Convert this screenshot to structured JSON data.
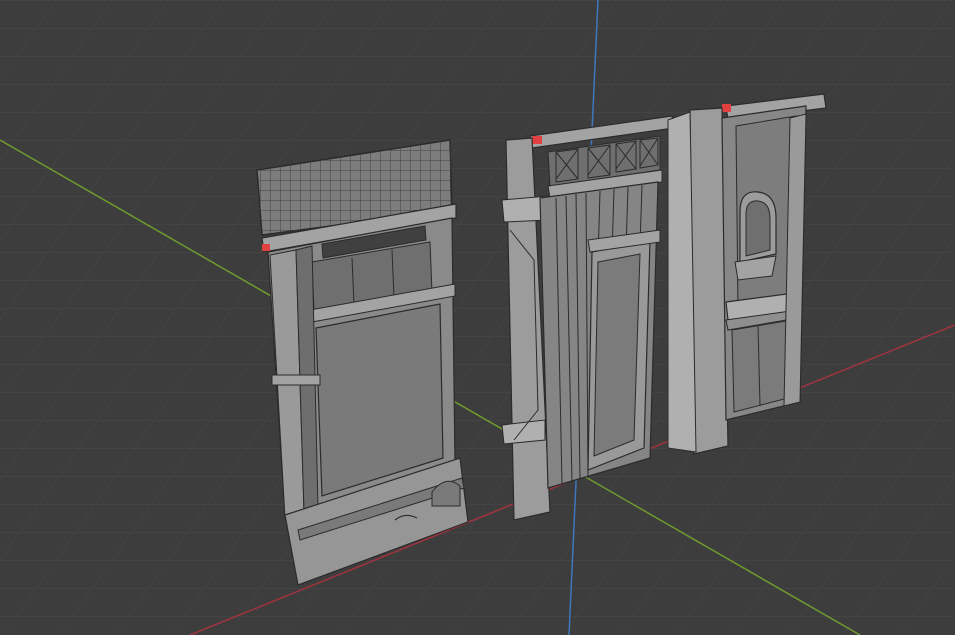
{
  "viewport": {
    "background": "#3d3d3d",
    "grid_color": "#4a4a4a",
    "axis_x_color": "#a0333f",
    "axis_y_color": "#6f9b2e",
    "axis_z_color": "#3f77bd"
  },
  "scene": {
    "object_base_color": "#8a8a8a",
    "object_light_color": "#a3a3a3",
    "object_shadow_color": "#6e6e6e",
    "wire_color": "#2b2b2b",
    "selection_color": "#e04040",
    "objects": [
      {
        "id": "facade-left",
        "icon": "facade-mesh"
      },
      {
        "id": "facade-middle",
        "icon": "facade-mesh"
      },
      {
        "id": "facade-right",
        "icon": "facade-mesh"
      }
    ]
  }
}
